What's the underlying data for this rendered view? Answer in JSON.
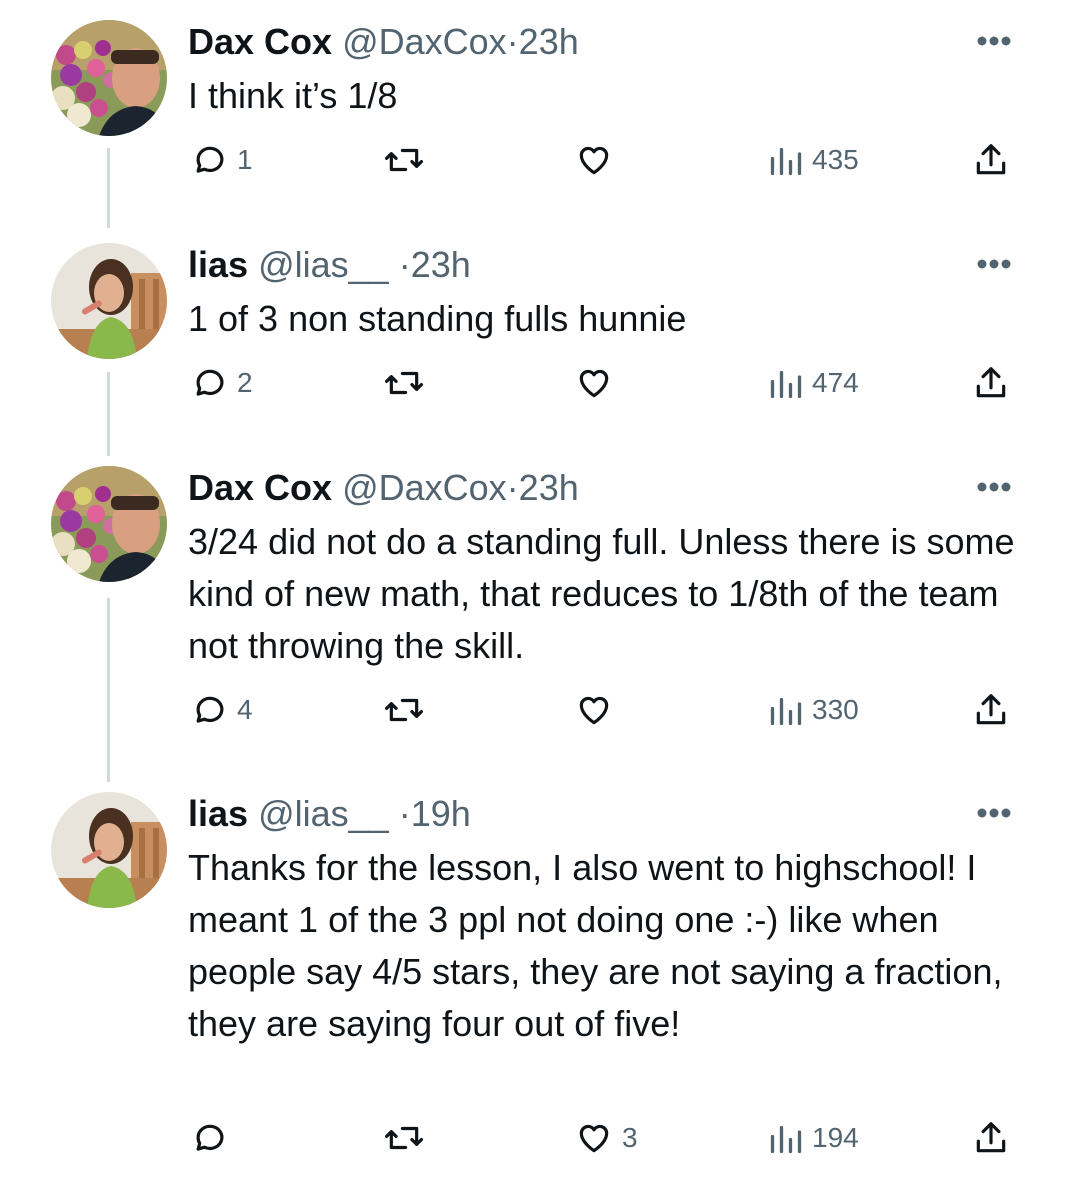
{
  "tweets": [
    {
      "name": "Dax Cox",
      "handle": "@DaxCox",
      "time": "23h",
      "text": "I think it’s 1/8",
      "replies": "1",
      "retweets": "",
      "likes": "",
      "views": "435"
    },
    {
      "name": "lias",
      "handle": "@lias__",
      "time": "23h",
      "text": "1 of 3 non standing fulls hunnie",
      "replies": "2",
      "retweets": "",
      "likes": "",
      "views": "474"
    },
    {
      "name": "Dax Cox",
      "handle": "@DaxCox",
      "time": "23h",
      "text": "3/24 did not do a standing full. Unless there is some kind of new math, that reduces to 1/8th of the team not throwing the skill.",
      "replies": "4",
      "retweets": "",
      "likes": "",
      "views": "330"
    },
    {
      "name": "lias",
      "handle": "@lias__",
      "time": "19h",
      "text": "Thanks for the lesson, I also went to highschool! I meant 1 of the 3 ppl not doing one :-) like when people say 4/5 stars, they are not saying a fraction, they are saying four out of five!",
      "replies": "",
      "retweets": "",
      "likes": "3",
      "views": "194"
    }
  ],
  "separator": "·",
  "icons": {
    "reply": "reply-bubble-icon",
    "retweet": "retweet-arrows-icon",
    "like": "heart-icon",
    "views": "bar-chart-icon",
    "share": "share-upload-icon",
    "more": "ellipsis-icon"
  },
  "colors": {
    "text": "#0f1419",
    "secondary": "#536471",
    "thread_line": "#cfd9de"
  }
}
